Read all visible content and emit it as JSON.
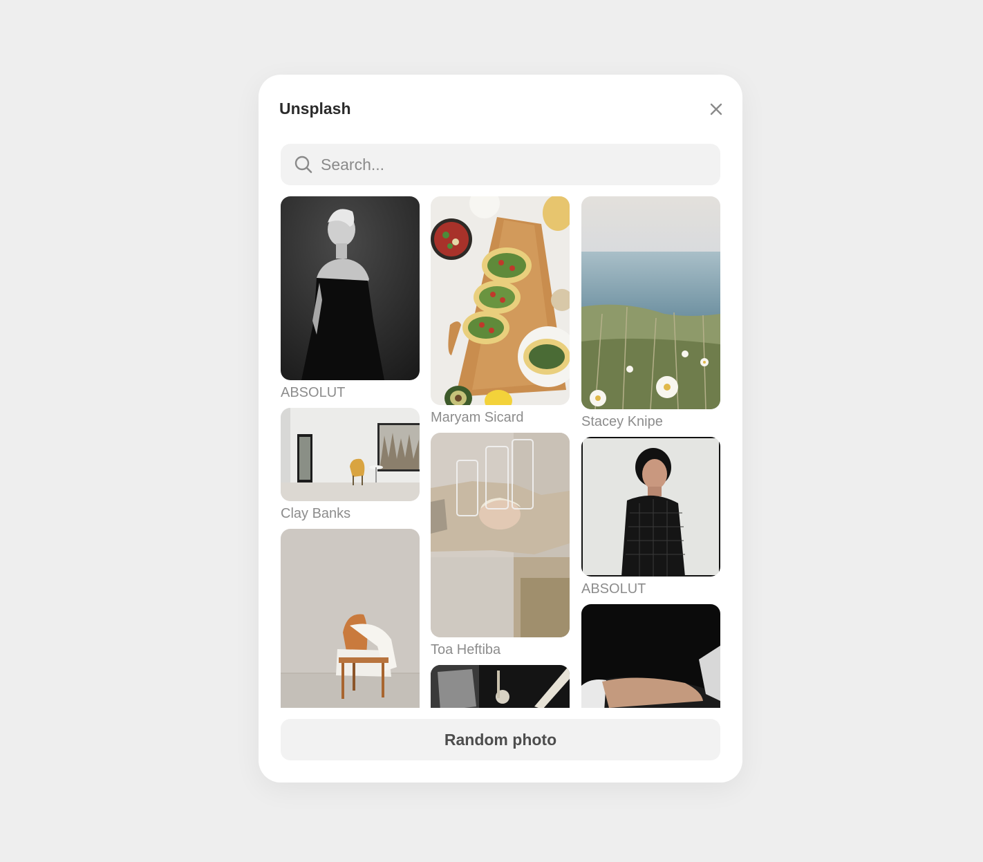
{
  "modal": {
    "title": "Unsplash",
    "close_icon": "close-icon"
  },
  "search": {
    "placeholder": "Search...",
    "value": "",
    "icon": "search-icon"
  },
  "columns": [
    {
      "items": [
        {
          "credit": "ABSOLUT",
          "subject": "woman-black-dress-bw-portrait"
        },
        {
          "credit": "Clay Banks",
          "subject": "white-room-armchair-window"
        },
        {
          "credit": "",
          "subject": "wooden-chair-white-cloth"
        }
      ]
    },
    {
      "items": [
        {
          "credit": "Maryam Sicard",
          "subject": "tacos-on-board-overhead"
        },
        {
          "credit": "Toa Heftiba",
          "subject": "glasses-reflection"
        },
        {
          "credit": "",
          "subject": "dark-still-life"
        }
      ]
    },
    {
      "items": [
        {
          "credit": "Stacey Knipe",
          "subject": "daisies-by-the-sea"
        },
        {
          "credit": "ABSOLUT",
          "subject": "woman-mesh-top-portrait"
        },
        {
          "credit": "",
          "subject": "hand-on-black"
        }
      ]
    }
  ],
  "footer": {
    "random_label": "Random photo"
  },
  "colors": {
    "page_bg": "#eeeeee",
    "modal_bg": "#ffffff",
    "field_bg": "#f2f2f2",
    "muted_text": "#8c8c8c"
  }
}
